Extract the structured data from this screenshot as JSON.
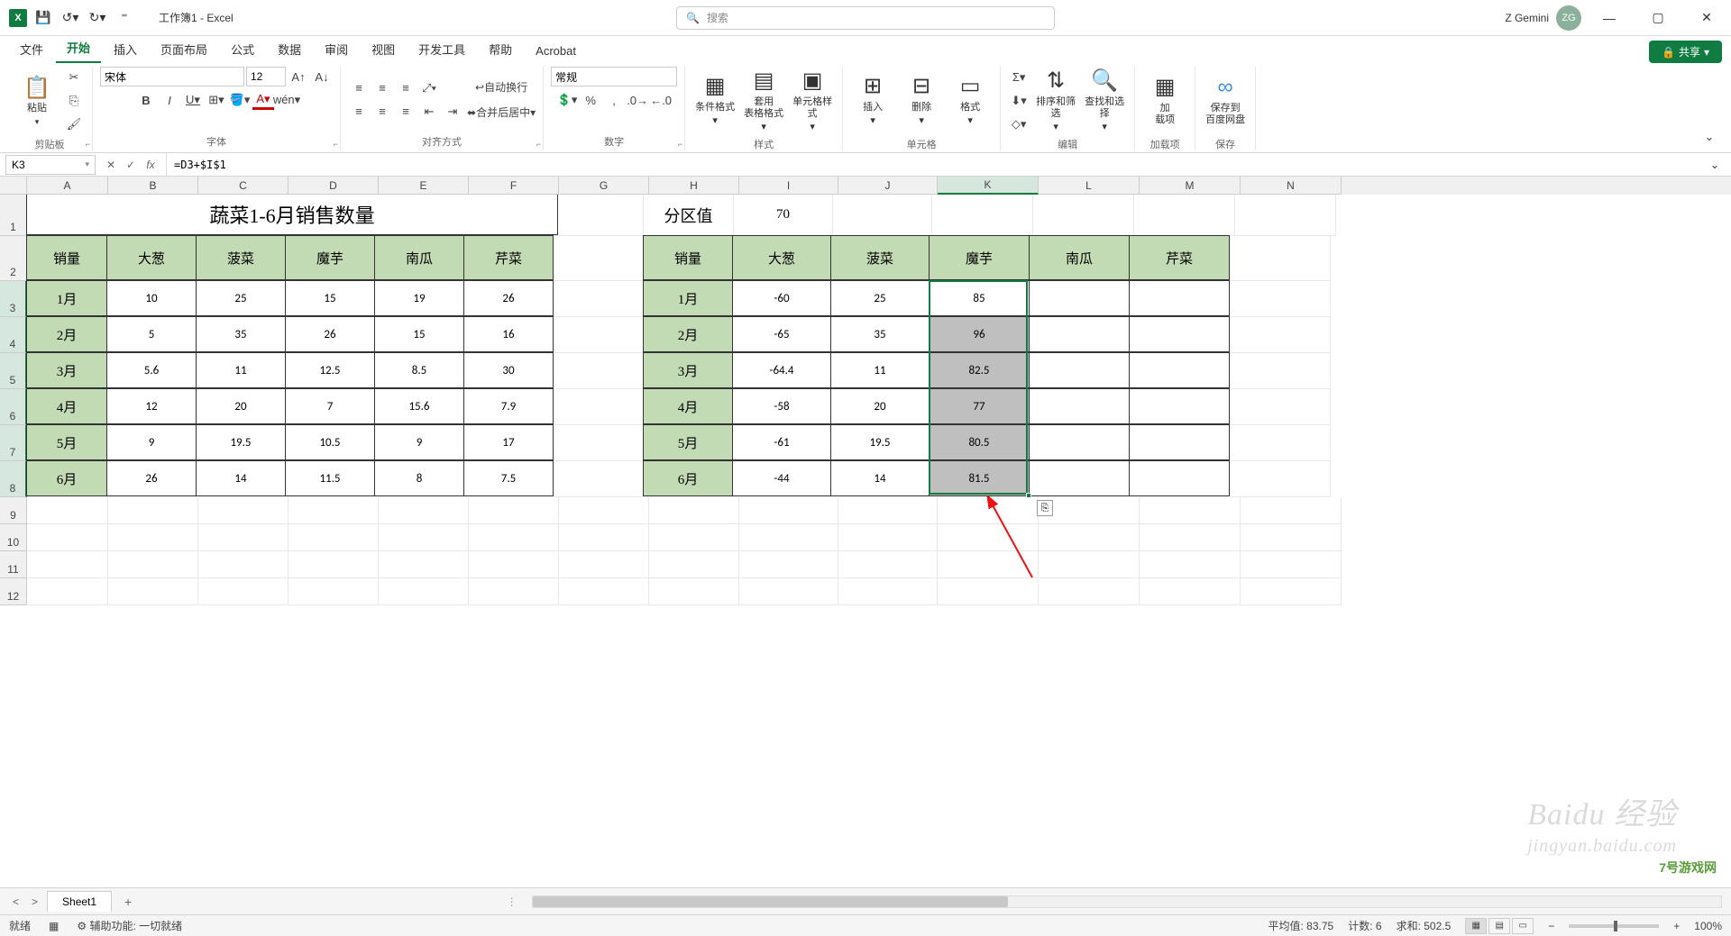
{
  "app": {
    "title": "工作簿1 - Excel",
    "search_placeholder": "搜索",
    "user": "Z Gemini",
    "avatar": "ZG"
  },
  "tabs": {
    "file": "文件",
    "home": "开始",
    "insert": "插入",
    "page": "页面布局",
    "formula": "公式",
    "data": "数据",
    "review": "审阅",
    "view": "视图",
    "dev": "开发工具",
    "help": "帮助",
    "acrobat": "Acrobat",
    "share": "共享"
  },
  "ribbon": {
    "clipboard": {
      "paste": "粘贴",
      "label": "剪贴板"
    },
    "font": {
      "name": "宋体",
      "size": "12",
      "label": "字体"
    },
    "align": {
      "wrap": "自动换行",
      "merge": "合并后居中",
      "label": "对齐方式"
    },
    "number": {
      "format": "常规",
      "label": "数字"
    },
    "styles": {
      "cond": "条件格式",
      "table": "套用\n表格格式",
      "cell": "单元格样式",
      "label": "样式"
    },
    "cells": {
      "insert": "插入",
      "delete": "删除",
      "format": "格式",
      "label": "单元格"
    },
    "editing": {
      "sort": "排序和筛选",
      "find": "查找和选择",
      "label": "编辑"
    },
    "addins": {
      "addin": "加\n载项",
      "label": "加载项"
    },
    "save": {
      "baidu": "保存到\n百度网盘",
      "label": "保存"
    }
  },
  "formula_bar": {
    "cell": "K3",
    "formula": "=D3+$I$1"
  },
  "table1": {
    "title": "蔬菜1-6月销售数量",
    "headers": [
      "销量",
      "大葱",
      "菠菜",
      "魔芋",
      "南瓜",
      "芹菜"
    ],
    "rows": [
      [
        "1月",
        "10",
        "25",
        "15",
        "19",
        "26"
      ],
      [
        "2月",
        "5",
        "35",
        "26",
        "15",
        "16"
      ],
      [
        "3月",
        "5.6",
        "11",
        "12.5",
        "8.5",
        "30"
      ],
      [
        "4月",
        "12",
        "20",
        "7",
        "15.6",
        "7.9"
      ],
      [
        "5月",
        "9",
        "19.5",
        "10.5",
        "9",
        "17"
      ],
      [
        "6月",
        "26",
        "14",
        "11.5",
        "8",
        "7.5"
      ]
    ]
  },
  "partition": {
    "label": "分区值",
    "value": "70"
  },
  "table2": {
    "headers": [
      "销量",
      "大葱",
      "菠菜",
      "魔芋",
      "南瓜",
      "芹菜"
    ],
    "rows": [
      [
        "1月",
        "-60",
        "25",
        "85",
        "",
        ""
      ],
      [
        "2月",
        "-65",
        "35",
        "96",
        "",
        ""
      ],
      [
        "3月",
        "-64.4",
        "11",
        "82.5",
        "",
        ""
      ],
      [
        "4月",
        "-58",
        "20",
        "77",
        "",
        ""
      ],
      [
        "5月",
        "-61",
        "19.5",
        "80.5",
        "",
        ""
      ],
      [
        "6月",
        "-44",
        "14",
        "81.5",
        "",
        ""
      ]
    ]
  },
  "sheet_tab": "Sheet1",
  "status": {
    "ready": "就绪",
    "access": "辅助功能: 一切就绪",
    "avg": "平均值: 83.75",
    "count": "计数: 6",
    "sum": "求和: 502.5",
    "zoom": "100%"
  },
  "chart_data": {
    "type": "table",
    "title": "蔬菜1-6月销售数量",
    "categories": [
      "1月",
      "2月",
      "3月",
      "4月",
      "5月",
      "6月"
    ],
    "series": [
      {
        "name": "大葱",
        "values": [
          10,
          5,
          5.6,
          12,
          9,
          26
        ]
      },
      {
        "name": "菠菜",
        "values": [
          25,
          35,
          11,
          20,
          19.5,
          14
        ]
      },
      {
        "name": "魔芋",
        "values": [
          15,
          26,
          12.5,
          7,
          10.5,
          11.5
        ]
      },
      {
        "name": "南瓜",
        "values": [
          19,
          15,
          8.5,
          15.6,
          9,
          8
        ]
      },
      {
        "name": "芹菜",
        "values": [
          26,
          16,
          30,
          7.9,
          17,
          7.5
        ]
      }
    ],
    "derived": {
      "partition_value": 70,
      "K_column_formula": "=D+$I$1",
      "K_values": [
        85,
        96,
        82.5,
        77,
        80.5,
        81.5
      ]
    }
  }
}
